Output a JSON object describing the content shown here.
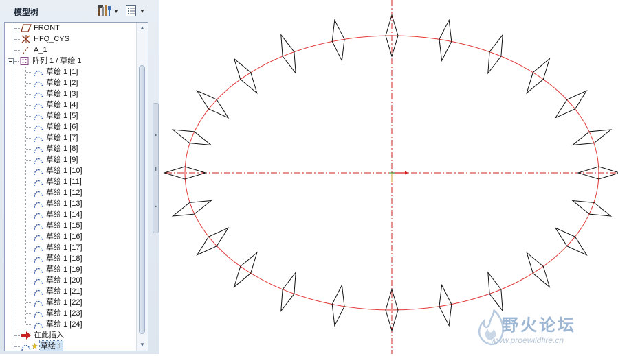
{
  "panel": {
    "title": "模型树",
    "settings_icon": "tree-settings-icon",
    "show_icon": "tree-show-icon"
  },
  "tree": {
    "items": [
      {
        "label": "FRONT",
        "icon": "datum-plane-icon",
        "level": 0
      },
      {
        "label": "HFQ_CYS",
        "icon": "coordinate-system-icon",
        "level": 0
      },
      {
        "label": "A_1",
        "icon": "datum-axis-icon",
        "level": 0
      },
      {
        "label": "阵列 1 / 草绘 1",
        "icon": "pattern-icon",
        "level": 0,
        "expanded": true
      },
      {
        "label": "草绘 1 [1]",
        "icon": "sketch-icon",
        "level": 1
      },
      {
        "label": "草绘 1 [2]",
        "icon": "sketch-icon",
        "level": 1
      },
      {
        "label": "草绘 1 [3]",
        "icon": "sketch-icon",
        "level": 1
      },
      {
        "label": "草绘 1 [4]",
        "icon": "sketch-icon",
        "level": 1
      },
      {
        "label": "草绘 1 [5]",
        "icon": "sketch-icon",
        "level": 1
      },
      {
        "label": "草绘 1 [6]",
        "icon": "sketch-icon",
        "level": 1
      },
      {
        "label": "草绘 1 [7]",
        "icon": "sketch-icon",
        "level": 1
      },
      {
        "label": "草绘 1 [8]",
        "icon": "sketch-icon",
        "level": 1
      },
      {
        "label": "草绘 1 [9]",
        "icon": "sketch-icon",
        "level": 1
      },
      {
        "label": "草绘 1 [10]",
        "icon": "sketch-icon",
        "level": 1
      },
      {
        "label": "草绘 1 [11]",
        "icon": "sketch-icon",
        "level": 1
      },
      {
        "label": "草绘 1 [12]",
        "icon": "sketch-icon",
        "level": 1
      },
      {
        "label": "草绘 1 [13]",
        "icon": "sketch-icon",
        "level": 1
      },
      {
        "label": "草绘 1 [14]",
        "icon": "sketch-icon",
        "level": 1
      },
      {
        "label": "草绘 1 [15]",
        "icon": "sketch-icon",
        "level": 1
      },
      {
        "label": "草绘 1 [16]",
        "icon": "sketch-icon",
        "level": 1
      },
      {
        "label": "草绘 1 [17]",
        "icon": "sketch-icon",
        "level": 1
      },
      {
        "label": "草绘 1 [18]",
        "icon": "sketch-icon",
        "level": 1
      },
      {
        "label": "草绘 1 [19]",
        "icon": "sketch-icon",
        "level": 1
      },
      {
        "label": "草绘 1 [20]",
        "icon": "sketch-icon",
        "level": 1
      },
      {
        "label": "草绘 1 [21]",
        "icon": "sketch-icon",
        "level": 1
      },
      {
        "label": "草绘 1 [22]",
        "icon": "sketch-icon",
        "level": 1
      },
      {
        "label": "草绘 1 [23]",
        "icon": "sketch-icon",
        "level": 1
      },
      {
        "label": "草绘 1 [24]",
        "icon": "sketch-icon",
        "level": 1
      },
      {
        "label": "在此插入",
        "icon": "insert-here-arrow-icon",
        "level": 0
      },
      {
        "label": "草绘 1",
        "icon": "sketch-icon",
        "level": 0,
        "selected": true
      }
    ]
  },
  "canvas": {
    "pattern_count": 24,
    "curve_color": "#e23a3a",
    "centerline_color": "#cc2222",
    "shape_color": "#111111",
    "background": "#ffffff"
  },
  "watermark": {
    "title": "野火论坛",
    "url": "www.proewildfire.cn"
  }
}
